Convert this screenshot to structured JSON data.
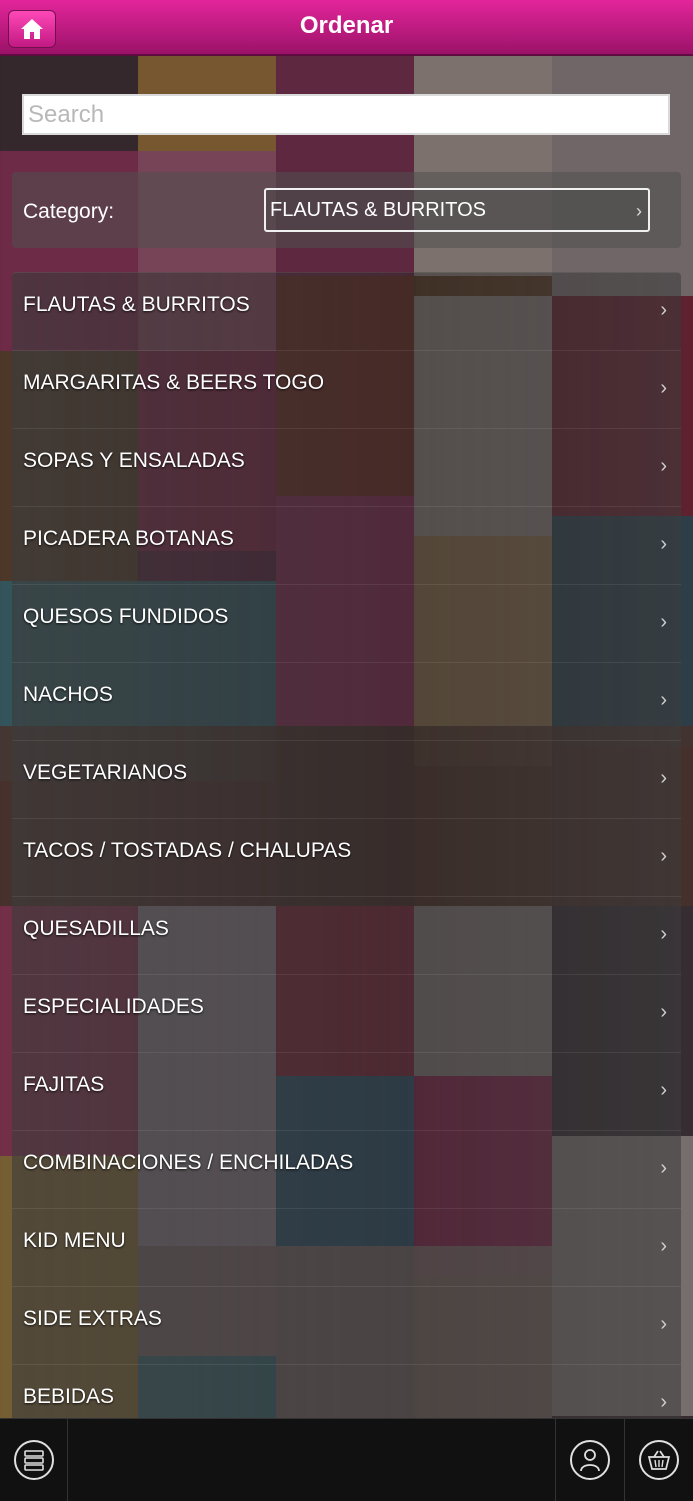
{
  "header": {
    "title": "Ordenar",
    "home_icon": "home-icon"
  },
  "search": {
    "placeholder": "Search",
    "value": ""
  },
  "category": {
    "label": "Category:",
    "selected": "FLAUTAS & BURRITOS"
  },
  "menu": {
    "items": [
      {
        "label": "FLAUTAS & BURRITOS"
      },
      {
        "label": "MARGARITAS & BEERS TOGO"
      },
      {
        "label": "SOPAS Y ENSALADAS"
      },
      {
        "label": "PICADERA BOTANAS"
      },
      {
        "label": "QUESOS FUNDIDOS"
      },
      {
        "label": "NACHOS"
      },
      {
        "label": "VEGETARIANOS"
      },
      {
        "label": "TACOS / TOSTADAS / CHALUPAS"
      },
      {
        "label": "QUESADILLAS"
      },
      {
        "label": "ESPECIALIDADES"
      },
      {
        "label": "FAJITAS"
      },
      {
        "label": "COMBINACIONES / ENCHILADAS"
      },
      {
        "label": "KID MENU"
      },
      {
        "label": "SIDE EXTRAS"
      },
      {
        "label": "BEBIDAS"
      }
    ]
  },
  "footer": {
    "left_icon": "server-icon",
    "user_icon": "user-icon",
    "cart_icon": "basket-icon"
  },
  "colors": {
    "header_top": "#e3259b",
    "header_bottom": "#9b1268",
    "footer_bg": "#111111"
  }
}
